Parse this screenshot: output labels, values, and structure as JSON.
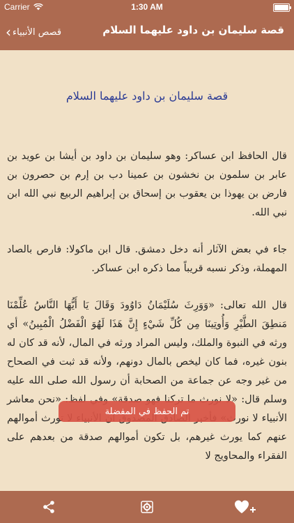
{
  "status": {
    "carrier": "Carrier",
    "time": "1:30 AM"
  },
  "nav": {
    "back_label": "قصص الأنبياء",
    "title": "قصة سليمان بن داود عليهما السلام"
  },
  "story": {
    "title": "قصة سليمان بن داود عليهما السلام",
    "paragraphs": [
      "قال الحافظ ابن عساكر: وهو سليمان بن داود بن أيشا بن عويد بن عابر بن سلمون بن نخشون بن عمينا دب بن إرم بن حصرون بن فارض بن يهوذا بن يعقوب بن إسحاق بن إبراهيم الربيع نبي الله ابن نبي الله.",
      "جاء في بعض الآثار أنه دخل دمشق. قال ابن ماكولا: فارص بالصاد المهملة، وذكر نسبه قريباً مما ذكره ابن عساكر.",
      "قال الله تعالى: «وَوَرِثَ سُلَيْمَانُ دَاوُودَ وَقَالَ يَا أَيُّهَا النَّاسُ عُلِّمْنَا مَنطِقَ الطَّيْرِ وَأُوتِينَا مِن كُلِّ شَيْءٍ إِنَّ هَذَا لَهُوَ الْفَضْلُ الْمُبِينُ» أي ورثه في النبوة والملك، وليس المراد ورثه في المال، لأنه قد كان له بنون غيره، فما كان ليخص بالمال دونهم، ولأنه قد ثبت في الصحاح من غير وجه عن جماعة من الصحابة أن رسول الله صلى الله عليه وسلم قال: «لا نورث ما تركنا فهو صدقة» وفي لفظ: «نحن معاشر الأنبياء لا نورث» فأخبر الصادق المصدوق أن الأنبياء لا تورث أموالهم عنهم كما يورث غيرهم، بل تكون أموالهم صدقة من بعدهم على الفقراء والمحاويج لا"
    ]
  },
  "toast": {
    "text": "تم الحفظ في المفضلة"
  },
  "colors": {
    "bar": "#ad6a50",
    "title_text": "#2a3a94",
    "toast": "#d85244"
  }
}
